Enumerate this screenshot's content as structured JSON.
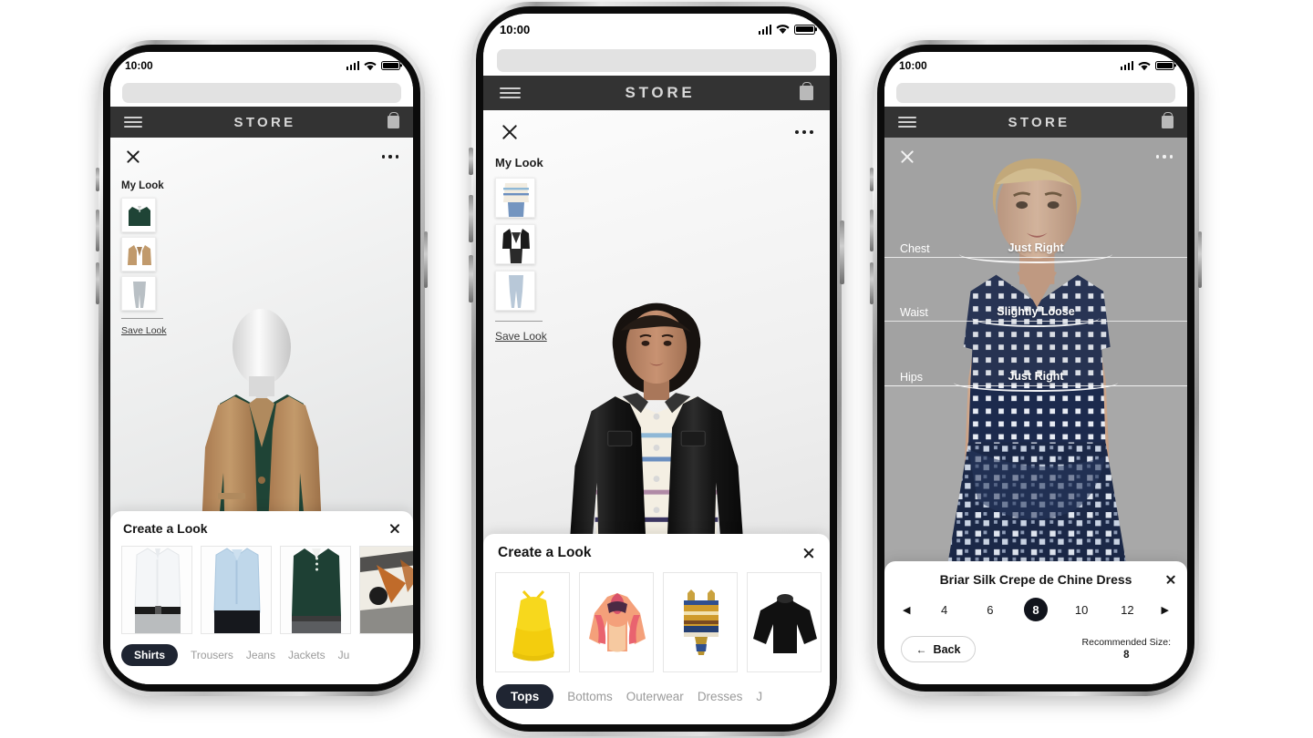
{
  "meta": {
    "background": "#ffffff",
    "accent": "#1f2532",
    "appbar_bg": "#333333"
  },
  "status_bar": {
    "time": "10:00",
    "signal_icon": "cellular-bars-icon",
    "wifi_icon": "wifi-icon",
    "battery_icon": "battery-icon"
  },
  "app_bar": {
    "menu_icon": "hamburger-menu-icon",
    "brand": "STORE",
    "cart_icon": "shopping-bag-icon"
  },
  "viewer_bar": {
    "close_icon": "close-x-icon",
    "more_icon": "more-options-icon"
  },
  "zoom_control": {
    "plus_icon": "zoom-in-plus-icon",
    "slider_name": "zoom-slider"
  },
  "phones": [
    {
      "id": "phone-left",
      "my_look": {
        "title": "My Look",
        "save_label": "Save Look",
        "items": [
          {
            "name": "green-polo-shirt",
            "label": "Green Polo Shirt"
          },
          {
            "name": "camel-blazer",
            "label": "Camel Blazer"
          },
          {
            "name": "grey-trousers",
            "label": "Grey Trousers"
          }
        ]
      },
      "sheet": {
        "title": "Create a Look",
        "close_icon": "close-x-icon",
        "cards": [
          {
            "name": "white-dress-shirt",
            "label": "White Dress Shirt"
          },
          {
            "name": "light-blue-dress-shirt",
            "label": "Light Blue Dress Shirt"
          },
          {
            "name": "green-polo-shirt",
            "label": "Green Polo Shirt"
          },
          {
            "name": "printed-shirt",
            "label": "Printed Shirt"
          }
        ],
        "tabs": [
          {
            "label": "Shirts",
            "active": true
          },
          {
            "label": "Trousers",
            "active": false
          },
          {
            "label": "Jeans",
            "active": false
          },
          {
            "label": "Jackets",
            "active": false
          },
          {
            "label": "Ju",
            "active": false
          }
        ]
      }
    },
    {
      "id": "phone-center",
      "my_look": {
        "title": "My Look",
        "save_label": "Save Look",
        "items": [
          {
            "name": "striped-sweater",
            "label": "Striped Sweater"
          },
          {
            "name": "black-denim-jacket",
            "label": "Black Denim Jacket"
          },
          {
            "name": "light-wash-jeans",
            "label": "Light Wash Jeans"
          }
        ]
      },
      "sheet": {
        "title": "Create a Look",
        "close_icon": "close-x-icon",
        "cards": [
          {
            "name": "yellow-lace-camisole",
            "label": "Yellow Lace Camisole"
          },
          {
            "name": "floral-print-blouse",
            "label": "Floral Print Blouse"
          },
          {
            "name": "embroidered-crop-top",
            "label": "Embroidered Crop Top"
          },
          {
            "name": "black-long-sleeve-top",
            "label": "Black Long Sleeve Top"
          }
        ],
        "tabs": [
          {
            "label": "Tops",
            "active": true
          },
          {
            "label": "Bottoms",
            "active": false
          },
          {
            "label": "Outerwear",
            "active": false
          },
          {
            "label": "Dresses",
            "active": false
          },
          {
            "label": "J",
            "active": false
          }
        ]
      }
    },
    {
      "id": "phone-right",
      "fit": {
        "rows": [
          {
            "label": "Chest",
            "value": "Just Right"
          },
          {
            "label": "Waist",
            "value": "Slightly Loose"
          },
          {
            "label": "Hips",
            "value": "Just Right"
          }
        ]
      },
      "sheet": {
        "product_title": "Briar Silk Crepe de Chine Dress",
        "close_icon": "close-x-icon",
        "prev_icon": "previous-arrow-icon",
        "next_icon": "next-arrow-icon",
        "sizes": [
          "4",
          "6",
          "8",
          "10",
          "12"
        ],
        "selected_size": "8",
        "back_label": "Back",
        "back_icon": "back-arrow-icon",
        "recommended_label": "Recommended Size:",
        "recommended_value": "8"
      }
    }
  ]
}
